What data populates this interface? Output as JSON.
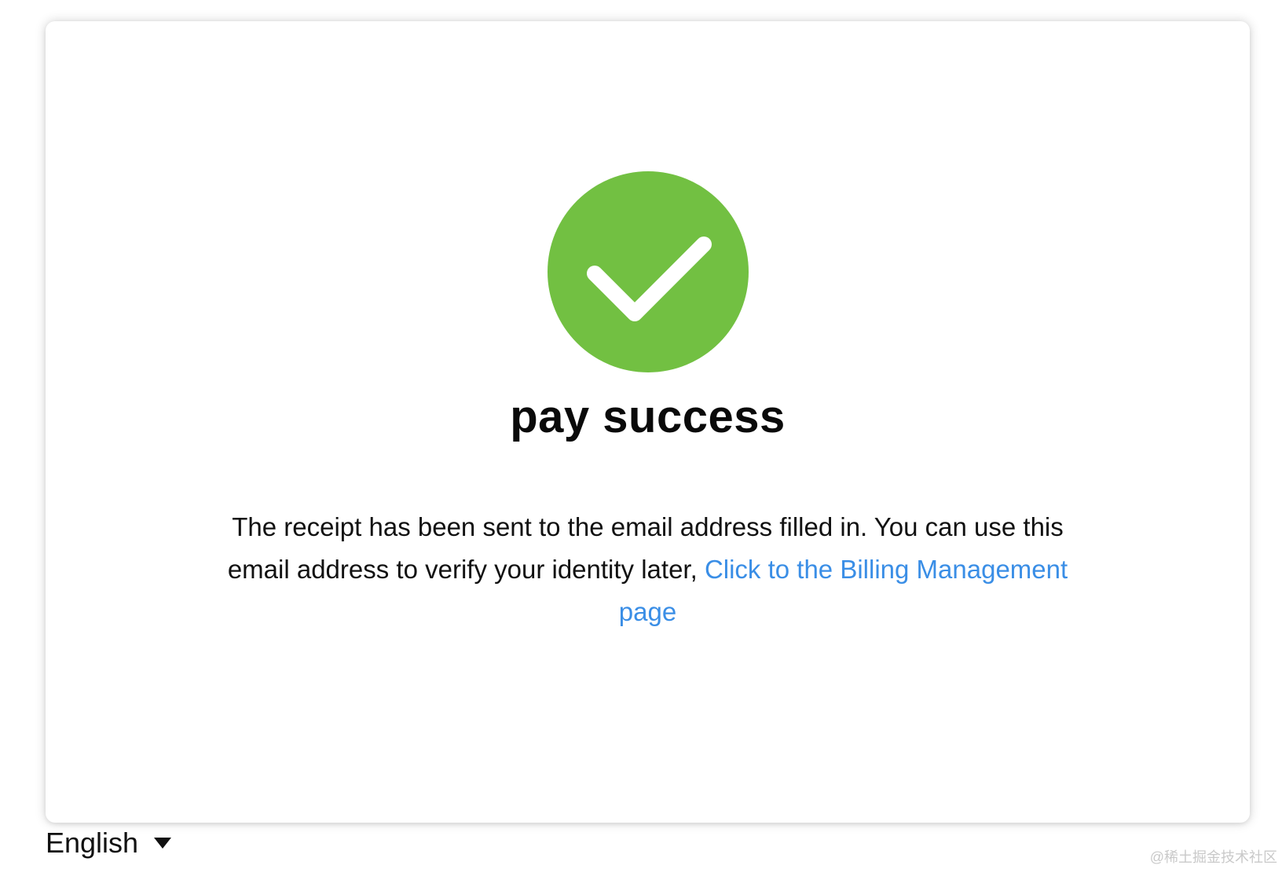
{
  "status": {
    "title": "pay success",
    "icon": "check-circle-icon",
    "icon_color": "#72c042"
  },
  "message": {
    "text": "The receipt has been sent to the email address filled in. You can use this email address to verify your identity later, ",
    "link_text": "Click to the Billing Management page",
    "link_color": "#3a8ee6"
  },
  "language": {
    "selected": "English",
    "icon": "caret-down-icon"
  },
  "watermark": {
    "text": "@稀土掘金技术社区"
  }
}
